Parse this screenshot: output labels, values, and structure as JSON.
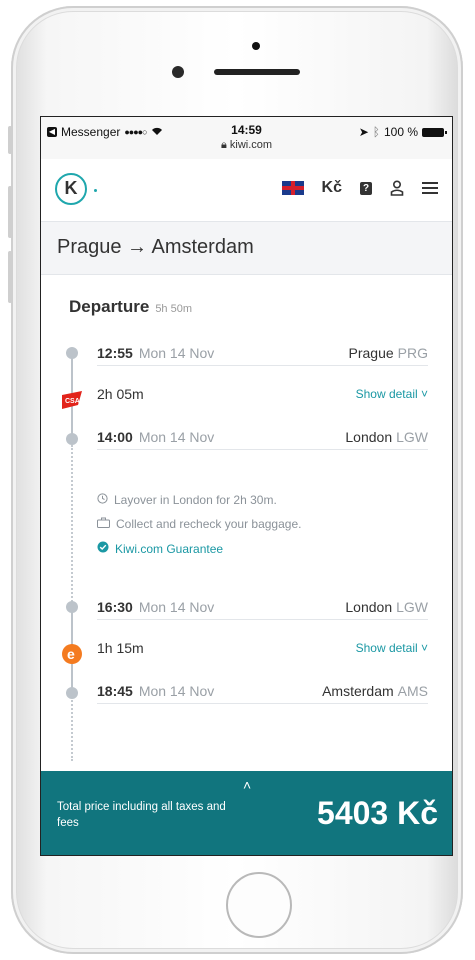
{
  "status_bar": {
    "app": "Messenger",
    "signal": "●●●●○",
    "time": "14:59",
    "url": "kiwi.com",
    "battery": "100 %"
  },
  "nav": {
    "logo_letter": "K",
    "currency": "Kč",
    "help_glyph": "?"
  },
  "trip": {
    "title": "Prague → Amsterdam",
    "departure_label": "Departure",
    "departure_duration": "5h 50m"
  },
  "segments": [
    {
      "dep_time": "12:55",
      "dep_date": "Mon 14 Nov",
      "dep_city": "Prague",
      "dep_code": "PRG",
      "duration": "2h 05m",
      "detail": "Show detail ˅",
      "arr_time": "14:00",
      "arr_date": "Mon 14 Nov",
      "arr_city": "London",
      "arr_code": "LGW",
      "airline_color": "#e2231a"
    },
    {
      "dep_time": "16:30",
      "dep_date": "Mon 14 Nov",
      "dep_city": "London",
      "dep_code": "LGW",
      "duration": "1h 15m",
      "detail": "Show detail ˅",
      "arr_time": "18:45",
      "arr_date": "Mon 14 Nov",
      "arr_city": "Amsterdam",
      "arr_code": "AMS",
      "airline_color": "#f47b20"
    }
  ],
  "layover": {
    "text": "Layover in London for 2h 30m.",
    "baggage": "Collect and recheck your baggage.",
    "guarantee": "Kiwi.com Guarantee"
  },
  "footer": {
    "chevron": "˄",
    "label": "Total price including all taxes and fees",
    "price": "5403 Kč"
  },
  "colors": {
    "accent": "#1b98a4",
    "footer_bg": "#11757e",
    "timeline": "#bcc3ca"
  }
}
